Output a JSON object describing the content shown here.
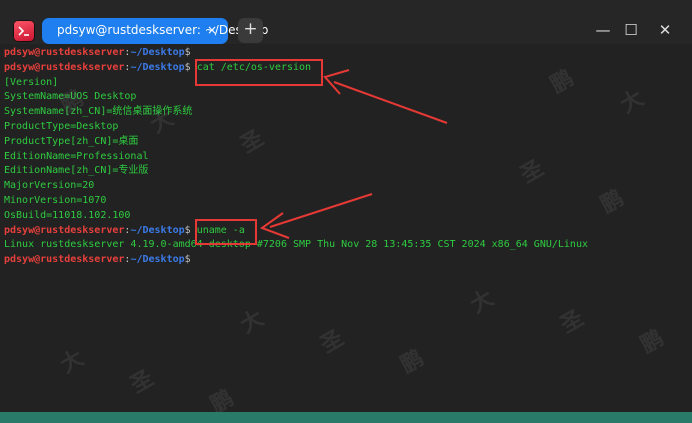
{
  "window": {
    "tab_title": "pdsyw@rustdeskserver: ~/Desktop",
    "tab_close": "×",
    "new_tab": "+",
    "minimize": "—",
    "maximize": "☐",
    "close": "✕"
  },
  "terminal": {
    "prompt_user": "pdsyw@rustdeskserver",
    "prompt_path": "~/Desktop",
    "lines": [
      {
        "type": "prompt",
        "cmd": ""
      },
      {
        "type": "prompt",
        "cmd": "cat /etc/os-version"
      },
      {
        "type": "out",
        "text": "[Version]"
      },
      {
        "type": "out",
        "text": "SystemName=UOS Desktop"
      },
      {
        "type": "out",
        "text": "SystemName[zh_CN]=统信桌面操作系统"
      },
      {
        "type": "out",
        "text": "ProductType=Desktop"
      },
      {
        "type": "out",
        "text": "ProductType[zh_CN]=桌面"
      },
      {
        "type": "out",
        "text": "EditionName=Professional"
      },
      {
        "type": "out",
        "text": "EditionName[zh_CN]=专业版"
      },
      {
        "type": "out",
        "text": "MajorVersion=20"
      },
      {
        "type": "out",
        "text": "MinorVersion=1070"
      },
      {
        "type": "out",
        "text": "OsBuild=11018.102.100"
      },
      {
        "type": "prompt",
        "cmd": "uname -a"
      },
      {
        "type": "out",
        "text": "Linux rustdeskserver 4.19.0-amd64-desktop #7206 SMP Thu Nov 28 13:45:35 CST 2024 x86_64 GNU/Linux"
      },
      {
        "type": "prompt",
        "cmd": ""
      }
    ]
  },
  "watermark": [
    "鹏",
    "大",
    "圣"
  ],
  "colors": {
    "prompt_user": "#e7403c",
    "prompt_path": "#3c7be8",
    "output": "#2ecc40",
    "annotation": "#e53935",
    "tab_active": "#1f7ef0"
  }
}
